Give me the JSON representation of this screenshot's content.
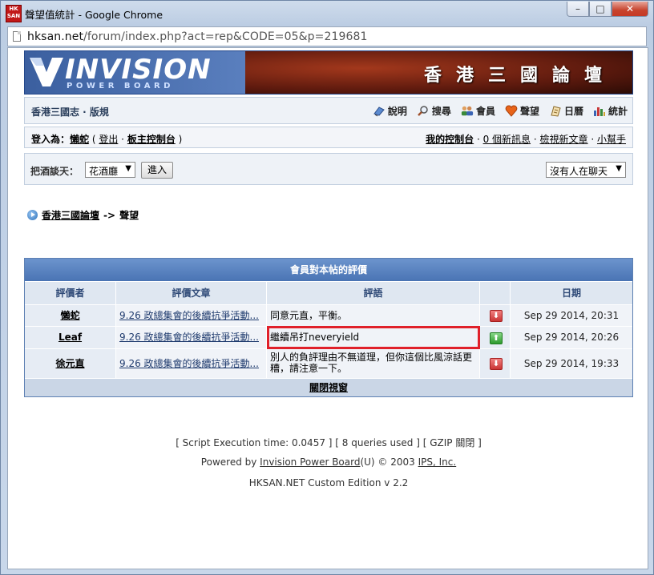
{
  "window": {
    "app_icon_text": "HK SAN",
    "title": "聲望值統計 - Google Chrome",
    "buttons": {
      "minimize": "–",
      "maximize": "□",
      "close": "✕"
    }
  },
  "address": {
    "domain": "hksan.net",
    "path": "/forum/index.php?act=rep&CODE=05&p=219681"
  },
  "banner": {
    "logo": "INVISION",
    "logo_sub": "POWER BOARD",
    "title": "香港三國論壇"
  },
  "nav": {
    "title": "香港三國志 · 版規",
    "links": [
      {
        "label": "說明",
        "icon": "help-icon"
      },
      {
        "label": "搜尋",
        "icon": "search-icon"
      },
      {
        "label": "會員",
        "icon": "members-icon"
      },
      {
        "label": "聲望",
        "icon": "heart-icon"
      },
      {
        "label": "日曆",
        "icon": "calendar-icon"
      },
      {
        "label": "統計",
        "icon": "stats-icon"
      }
    ]
  },
  "userbar": {
    "logged_in_as": "登入為：",
    "username": "懶蛇",
    "logout": "登出",
    "mod_cp": "板主控制台",
    "my_controls": "我的控制台",
    "new_messages": "0 個新訊息",
    "view_new": "檢視新文章",
    "helper": "小幫手"
  },
  "chat": {
    "label": "把酒談天：",
    "room_select": "花酒廳",
    "go_button": "進入",
    "status_select": "沒有人在聊天"
  },
  "breadcrumb": {
    "forum": "香港三國論壇",
    "separator": "->",
    "current": "聲望"
  },
  "ratings": {
    "title": "會員對本帖的評價",
    "headers": [
      "評價者",
      "評價文章",
      "評語",
      "",
      "日期"
    ],
    "rows": [
      {
        "rater": "懶蛇",
        "post": "9.26 政總集會的後續抗爭活動...",
        "comment": "同意元直，平衡。",
        "type": "negative",
        "date": "Sep 29 2014, 20:31"
      },
      {
        "rater": "Leaf",
        "post": "9.26 政總集會的後續抗爭活動...",
        "comment": "繼續吊打neveryield",
        "type": "positive",
        "date": "Sep 29 2014, 20:26"
      },
      {
        "rater": "徐元直",
        "post": "9.26 政總集會的後續抗爭活動...",
        "comment": "別人的負評理由不無道理，但你這個比風涼話更糟，請注意一下。",
        "type": "negative",
        "date": "Sep 29 2014, 19:33"
      }
    ],
    "close": "關閉視窗"
  },
  "footer": {
    "stats": "[ Script Execution time: 0.0457 ]  [ 8 queries used ]  [ GZIP 關閉 ]",
    "powered_prefix": "Powered by ",
    "powered_link": "Invision Power Board",
    "powered_mid": "(U) © 2003  ",
    "ips_link": "IPS, Inc.",
    "edition": "HKSAN.NET Custom Edition v 2.2"
  },
  "colors": {
    "highlight": "#e0202a",
    "header_blue": "#4a74b4",
    "negative": "#c93434",
    "positive": "#2e9b2e"
  }
}
